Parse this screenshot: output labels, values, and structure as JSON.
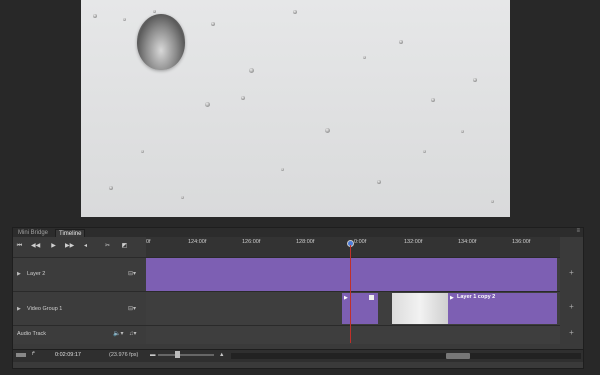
{
  "tabs": {
    "mini_bridge": "Mini Bridge",
    "timeline": "Timeline"
  },
  "ruler": {
    "ticks": [
      "0f",
      "124:00f",
      "126:00f",
      "128:00f",
      "0:00f",
      "132:00f",
      "134:00f",
      "136:00f"
    ]
  },
  "tracks": [
    {
      "name": "Layer 2"
    },
    {
      "name": "Video Group 1"
    },
    {
      "name": "Audio Track"
    }
  ],
  "clips": {
    "layer_copy_label": "Layer 1 copy 2"
  },
  "status": {
    "timecode": "0:02:09:17",
    "fps": "(23.976 fps)"
  },
  "colors": {
    "clip": "#7d5fb3",
    "playhead": "#c0302a",
    "panel": "#3a3a3a"
  }
}
